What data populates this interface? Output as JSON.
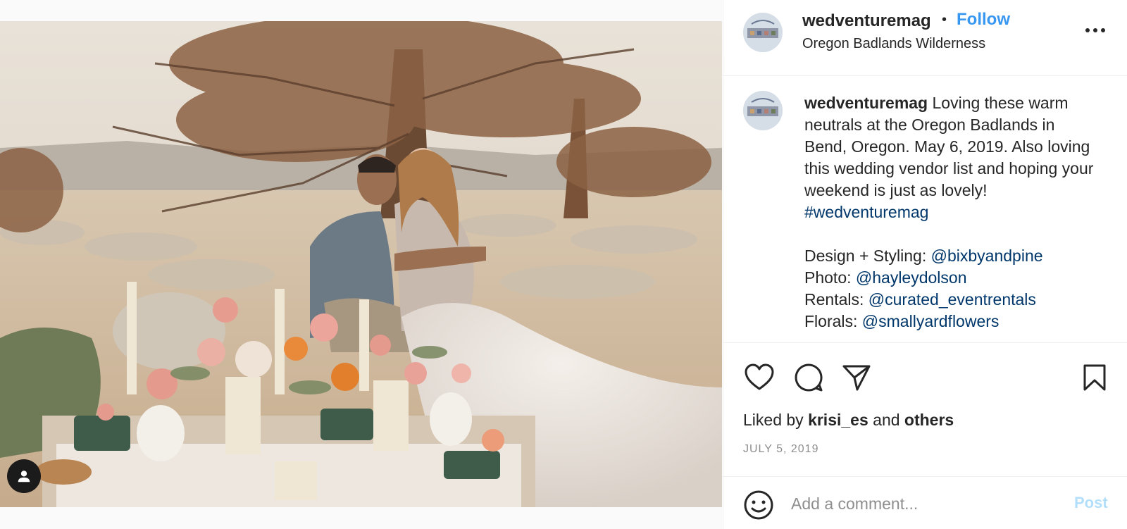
{
  "post": {
    "author": "wedventuremag",
    "follow_label": "Follow",
    "separator": "•",
    "location": "Oregon Badlands Wilderness",
    "caption": {
      "username": "wedventuremag",
      "text_1": " Loving these warm neutrals at the Oregon Badlands in Bend, Oregon. May 6, 2019. Also loving this wedding vendor list and hoping your weekend is just as lovely! ",
      "hashtag": "#wedventuremag",
      "credits": [
        {
          "label": "Design + Styling: ",
          "handle": "@bixbyandpine"
        },
        {
          "label": "Photo: ",
          "handle": "@hayleydolson"
        },
        {
          "label": "Rentals: ",
          "handle": "@curated_eventrentals"
        },
        {
          "label": "Florals: ",
          "handle": "@smallyardflowers"
        }
      ]
    },
    "likes": {
      "prefix": "Liked by ",
      "user": "krisi_es",
      "middle": " and ",
      "others": "others"
    },
    "date": "JULY 5, 2019"
  },
  "comment": {
    "placeholder": "Add a comment...",
    "post_label": "Post"
  },
  "icons": {
    "more": "more-options-icon",
    "like": "heart-icon",
    "comment": "comment-icon",
    "share": "share-icon",
    "save": "bookmark-icon",
    "emoji": "emoji-icon",
    "user_tag": "user-icon"
  },
  "colors": {
    "follow": "#3897f0",
    "link": "#00376b",
    "post_disabled": "#b2dffc",
    "muted": "#8e8e8e"
  }
}
